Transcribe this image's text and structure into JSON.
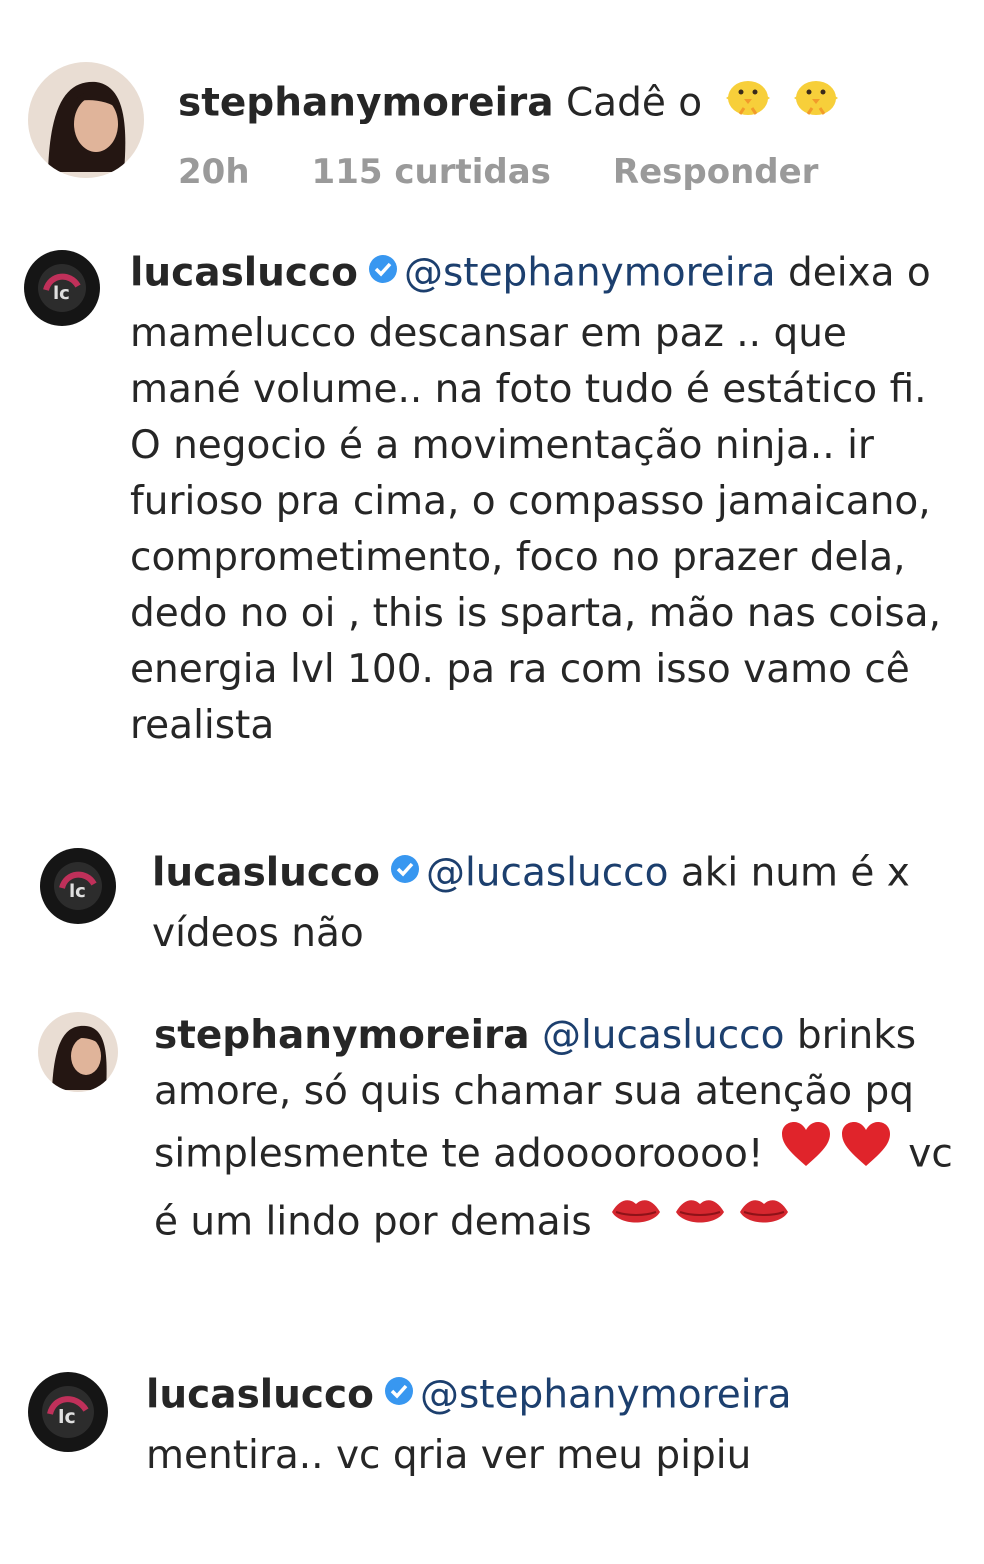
{
  "comments": [
    {
      "user": "stephanymoreira",
      "text": "Cadê o",
      "emoji": [
        "chick-icon",
        "chick-icon"
      ],
      "meta": {
        "time": "20h",
        "likes": "115 curtidas",
        "reply": "Responder"
      }
    },
    {
      "user": "lucaslucco",
      "verified": true,
      "mention": "@stephanymoreira",
      "text": "deixa o mamelucco descansar em paz .. que mané volume.. na foto tudo é estático fi. O negocio é a movimentação ninja.. ir furioso pra cima, o compasso jamaicano, comprometimento, foco no prazer dela, dedo no oi , this is sparta, mão nas coisa, energia lvl 100. pa ra com isso vamo cê realista"
    },
    {
      "user": "lucaslucco",
      "verified": true,
      "mention": "@lucaslucco",
      "text": "aki num é x vídeos não"
    },
    {
      "user": "stephanymoreira",
      "mention": "@lucaslucco",
      "text_a": "brinks amore, só quis chamar sua atenção pq simplesmente te adooooroooo!",
      "emoji_a": [
        "red-heart-icon",
        "red-heart-icon"
      ],
      "text_b": "vc é um lindo por demais",
      "emoji_b": [
        "kiss-mark-icon",
        "kiss-mark-icon",
        "kiss-mark-icon"
      ]
    },
    {
      "user": "lucaslucco",
      "verified": true,
      "mention": "@stephanymoreira",
      "text": "mentira.. vc qria ver meu pipiu"
    }
  ],
  "colors": {
    "verified_blue": "#3897f0",
    "meta_gray": "#9a9a9a",
    "mention_blue": "#1c3f6e"
  }
}
